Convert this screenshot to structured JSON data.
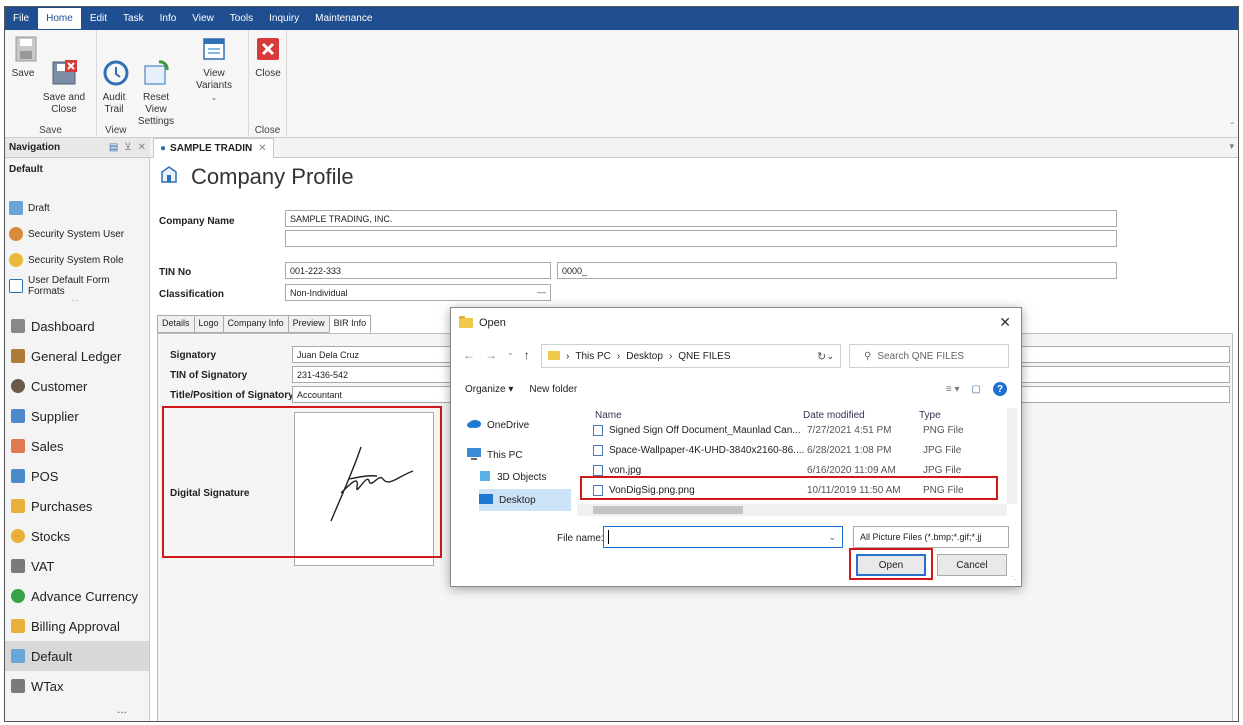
{
  "menu": {
    "items": [
      "File",
      "Home",
      "Edit",
      "Task",
      "Info",
      "View",
      "Tools",
      "Inquiry",
      "Maintenance"
    ],
    "active": "Home"
  },
  "ribbon": {
    "save_label": "Save",
    "save_close_label": "Save and\nClose",
    "audit_label": "Audit\nTrail",
    "reset_view_label": "Reset View\nSettings",
    "view_variants_label": "View Variants",
    "close_label": "Close",
    "group_save": "Save",
    "group_view": "View",
    "group_close": "Close"
  },
  "nav": {
    "header": "Navigation",
    "section": "Default",
    "small_items": [
      "Draft",
      "Security System User",
      "Security System Role",
      "User Default Form Formats"
    ],
    "big_items": [
      "Dashboard",
      "General Ledger",
      "Customer",
      "Supplier",
      "Sales",
      "POS",
      "Purchases",
      "Stocks",
      "VAT",
      "Advance Currency",
      "Billing Approval",
      "Default",
      "WTax"
    ],
    "selected": "Default",
    "more": "..."
  },
  "doc_tab": "SAMPLE TRADIN",
  "form": {
    "title": "Company Profile",
    "company_name_label": "Company Name",
    "company_name": "SAMPLE TRADING, INC.",
    "tin_label": "TIN No",
    "tin": "001-222-333",
    "tin_branch": "0000_",
    "classification_label": "Classification",
    "classification": "Non-Individual",
    "tabs": [
      "Details",
      "Logo",
      "Company Info",
      "Preview",
      "BIR Info"
    ],
    "active_tab": "BIR Info",
    "signatory_label": "Signatory",
    "signatory": "Juan Dela Cruz",
    "tin_signatory_label": "TIN of Signatory",
    "tin_signatory": "231-436-542",
    "title_label": "Title/Position of Signatory",
    "title_value": "Accountant",
    "digital_signature_label": "Digital Signature"
  },
  "dialog": {
    "title": "Open",
    "path": [
      "This PC",
      "Desktop",
      "QNE FILES"
    ],
    "search_placeholder": "Search QNE FILES",
    "organize": "Organize",
    "new_folder": "New folder",
    "tree": [
      "OneDrive",
      "This PC",
      "3D Objects",
      "Desktop"
    ],
    "tree_selected": "Desktop",
    "columns": [
      "Name",
      "Date modified",
      "Type"
    ],
    "files": [
      {
        "name": "Signed Sign Off Document_Maunlad Can...",
        "date": "7/27/2021 4:51 PM",
        "type": "PNG File"
      },
      {
        "name": "Space-Wallpaper-4K-UHD-3840x2160-86....",
        "date": "6/28/2021 1:08 PM",
        "type": "JPG File"
      },
      {
        "name": "von.jpg",
        "date": "6/16/2020 11:09 AM",
        "type": "JPG File"
      },
      {
        "name": "VonDigSig.png.png",
        "date": "10/11/2019 11:50 AM",
        "type": "PNG File"
      }
    ],
    "filename_label": "File name:",
    "filename_value": "",
    "filetype": "All Picture Files (*.bmp;*.gif;*.jj",
    "open_label": "Open",
    "cancel_label": "Cancel"
  },
  "colors": {
    "menubar": "#1f4e91",
    "highlight": "#d01818",
    "selection": "#cce3f7"
  }
}
